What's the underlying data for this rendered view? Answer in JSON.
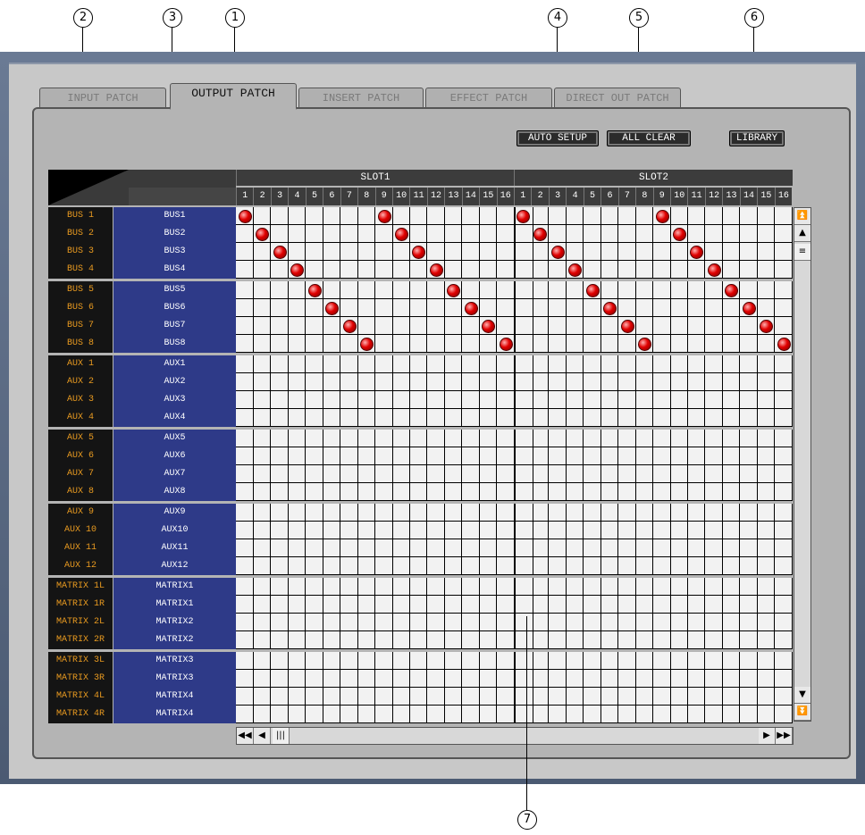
{
  "callouts": [
    "1",
    "2",
    "3",
    "4",
    "5",
    "6",
    "7"
  ],
  "tabs": [
    "INPUT PATCH",
    "OUTPUT PATCH",
    "INSERT PATCH",
    "EFFECT PATCH",
    "DIRECT OUT PATCH"
  ],
  "active_tab": "OUTPUT PATCH",
  "buttons": {
    "auto_setup": "AUTO SETUP",
    "all_clear": "ALL CLEAR",
    "library": "LIBRARY"
  },
  "slots": [
    "SLOT1",
    "SLOT2"
  ],
  "columns": [
    "1",
    "2",
    "3",
    "4",
    "5",
    "6",
    "7",
    "8",
    "9",
    "10",
    "11",
    "12",
    "13",
    "14",
    "15",
    "16"
  ],
  "rows": [
    {
      "label": "BUS 1",
      "name": "BUS1"
    },
    {
      "label": "BUS 2",
      "name": "BUS2"
    },
    {
      "label": "BUS 3",
      "name": "BUS3"
    },
    {
      "label": "BUS 4",
      "name": "BUS4"
    },
    {
      "label": "BUS 5",
      "name": "BUS5"
    },
    {
      "label": "BUS 6",
      "name": "BUS6"
    },
    {
      "label": "BUS 7",
      "name": "BUS7"
    },
    {
      "label": "BUS 8",
      "name": "BUS8"
    },
    {
      "label": "AUX 1",
      "name": "AUX1"
    },
    {
      "label": "AUX 2",
      "name": "AUX2"
    },
    {
      "label": "AUX 3",
      "name": "AUX3"
    },
    {
      "label": "AUX 4",
      "name": "AUX4"
    },
    {
      "label": "AUX 5",
      "name": "AUX5"
    },
    {
      "label": "AUX 6",
      "name": "AUX6"
    },
    {
      "label": "AUX 7",
      "name": "AUX7"
    },
    {
      "label": "AUX 8",
      "name": "AUX8"
    },
    {
      "label": "AUX 9",
      "name": "AUX9"
    },
    {
      "label": "AUX 10",
      "name": "AUX10"
    },
    {
      "label": "AUX 11",
      "name": "AUX11"
    },
    {
      "label": "AUX 12",
      "name": "AUX12"
    },
    {
      "label": "MATRIX 1L",
      "name": "MATRIX1"
    },
    {
      "label": "MATRIX 1R",
      "name": "MATRIX1"
    },
    {
      "label": "MATRIX 2L",
      "name": "MATRIX2"
    },
    {
      "label": "MATRIX 2R",
      "name": "MATRIX2"
    },
    {
      "label": "MATRIX 3L",
      "name": "MATRIX3"
    },
    {
      "label": "MATRIX 3R",
      "name": "MATRIX3"
    },
    {
      "label": "MATRIX 4L",
      "name": "MATRIX4"
    },
    {
      "label": "MATRIX 4R",
      "name": "MATRIX4"
    }
  ],
  "patches": [
    {
      "row": 0,
      "slot": 0,
      "col": 0
    },
    {
      "row": 0,
      "slot": 0,
      "col": 8
    },
    {
      "row": 0,
      "slot": 1,
      "col": 0
    },
    {
      "row": 0,
      "slot": 1,
      "col": 8
    },
    {
      "row": 1,
      "slot": 0,
      "col": 1
    },
    {
      "row": 1,
      "slot": 0,
      "col": 9
    },
    {
      "row": 1,
      "slot": 1,
      "col": 1
    },
    {
      "row": 1,
      "slot": 1,
      "col": 9
    },
    {
      "row": 2,
      "slot": 0,
      "col": 2
    },
    {
      "row": 2,
      "slot": 0,
      "col": 10
    },
    {
      "row": 2,
      "slot": 1,
      "col": 2
    },
    {
      "row": 2,
      "slot": 1,
      "col": 10
    },
    {
      "row": 3,
      "slot": 0,
      "col": 3
    },
    {
      "row": 3,
      "slot": 0,
      "col": 11
    },
    {
      "row": 3,
      "slot": 1,
      "col": 3
    },
    {
      "row": 3,
      "slot": 1,
      "col": 11
    },
    {
      "row": 4,
      "slot": 0,
      "col": 4
    },
    {
      "row": 4,
      "slot": 0,
      "col": 12
    },
    {
      "row": 4,
      "slot": 1,
      "col": 4
    },
    {
      "row": 4,
      "slot": 1,
      "col": 12
    },
    {
      "row": 5,
      "slot": 0,
      "col": 5
    },
    {
      "row": 5,
      "slot": 0,
      "col": 13
    },
    {
      "row": 5,
      "slot": 1,
      "col": 5
    },
    {
      "row": 5,
      "slot": 1,
      "col": 13
    },
    {
      "row": 6,
      "slot": 0,
      "col": 6
    },
    {
      "row": 6,
      "slot": 0,
      "col": 14
    },
    {
      "row": 6,
      "slot": 1,
      "col": 6
    },
    {
      "row": 6,
      "slot": 1,
      "col": 14
    },
    {
      "row": 7,
      "slot": 0,
      "col": 7
    },
    {
      "row": 7,
      "slot": 0,
      "col": 15
    },
    {
      "row": 7,
      "slot": 1,
      "col": 7
    },
    {
      "row": 7,
      "slot": 1,
      "col": 15
    }
  ],
  "colors": {
    "label_text": "#e89a20",
    "name_bg": "#2e3a88",
    "patch": "#e00000"
  }
}
